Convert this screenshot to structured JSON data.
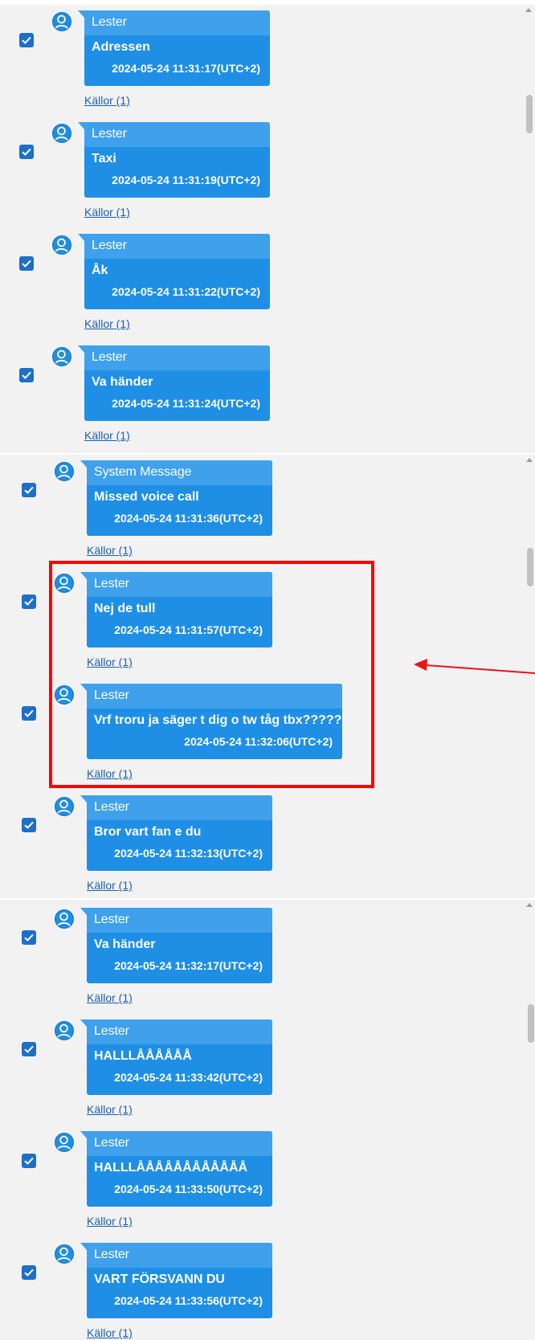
{
  "panels": [
    {
      "messages": [
        {
          "sender": "Lester",
          "text": "Adressen",
          "time": "2024-05-24 11:31:17(UTC+2)",
          "sources": "Källor (1)"
        },
        {
          "sender": "Lester",
          "text": "Taxi",
          "time": "2024-05-24 11:31:19(UTC+2)",
          "sources": "Källor (1)"
        },
        {
          "sender": "Lester",
          "text": "Åk",
          "time": "2024-05-24 11:31:22(UTC+2)",
          "sources": "Källor (1)"
        },
        {
          "sender": "Lester",
          "text": "Va händer",
          "time": "2024-05-24 11:31:24(UTC+2)",
          "sources": "Källor (1)"
        }
      ]
    },
    {
      "messages": [
        {
          "sender": "System Message",
          "text": "Missed voice call",
          "time": "2024-05-24 11:31:36(UTC+2)",
          "sources": "Källor (1)"
        },
        {
          "sender": "Lester",
          "text": "Nej de tull",
          "time": "2024-05-24 11:31:57(UTC+2)",
          "sources": "Källor (1)"
        },
        {
          "sender": "Lester",
          "text": "Vrf troru ja säger t dig o tw tåg tbx?????",
          "time": "2024-05-24 11:32:06(UTC+2)",
          "sources": "Källor (1)"
        },
        {
          "sender": "Lester",
          "text": "Bror vart fan e du",
          "time": "2024-05-24 11:32:13(UTC+2)",
          "sources": "Källor (1)"
        }
      ]
    },
    {
      "messages": [
        {
          "sender": "Lester",
          "text": "Va händer",
          "time": "2024-05-24 11:32:17(UTC+2)",
          "sources": "Källor (1)"
        },
        {
          "sender": "Lester",
          "text": "HALLLÅÅÅÅÅÅ",
          "time": "2024-05-24 11:33:42(UTC+2)",
          "sources": "Källor (1)"
        },
        {
          "sender": "Lester",
          "text": "HALLLÅÅÅÅÅÅÅÅÅÅÅÅ",
          "time": "2024-05-24 11:33:50(UTC+2)",
          "sources": "Källor (1)"
        },
        {
          "sender": "Lester",
          "text": "VART FÖRSVANN DU",
          "time": "2024-05-24 11:33:56(UTC+2)",
          "sources": "Källor (1)"
        }
      ]
    }
  ],
  "colors": {
    "bubble": "#1f8fe6",
    "bubble_header": "#3fa1ec",
    "checkbox": "#1e6fc7",
    "link": "#1a5fb4",
    "highlight": "#ff0000",
    "panel_bg": "#f2f2f2"
  },
  "icons": {
    "checkbox": "checkmark-icon",
    "avatar": "user-avatar-icon",
    "annotation": "arrow-left-icon"
  }
}
